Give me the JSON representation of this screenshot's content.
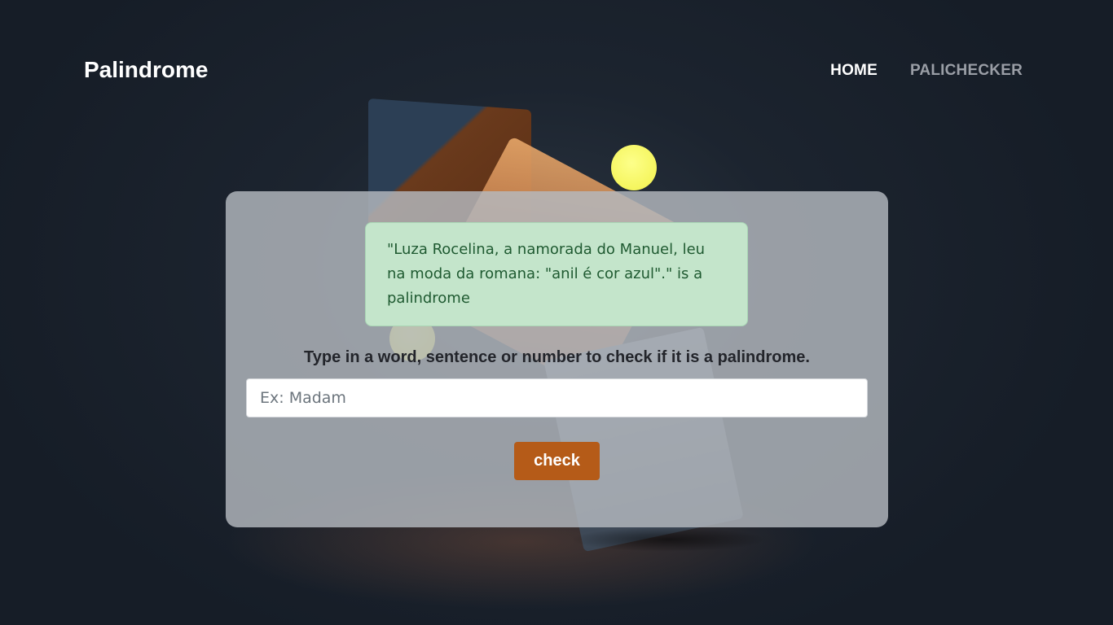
{
  "header": {
    "brand": "Palindrome",
    "nav": [
      {
        "label": "HOME",
        "active": true
      },
      {
        "label": "PALICHECKER",
        "active": false
      }
    ]
  },
  "main": {
    "result_message": "\"Luza Rocelina, a namorada do Manuel, leu na moda da romana: \"anil é cor azul\".\" is a palindrome",
    "prompt": "Type in a word, sentence or number to check if it is a palindrome.",
    "input": {
      "value": "",
      "placeholder": "Ex: Madam"
    },
    "check_button": "check"
  },
  "colors": {
    "accent": "#b55b18",
    "success_bg": "#c4e5cb",
    "success_text": "#1f5a31",
    "background": "#1c242f"
  }
}
